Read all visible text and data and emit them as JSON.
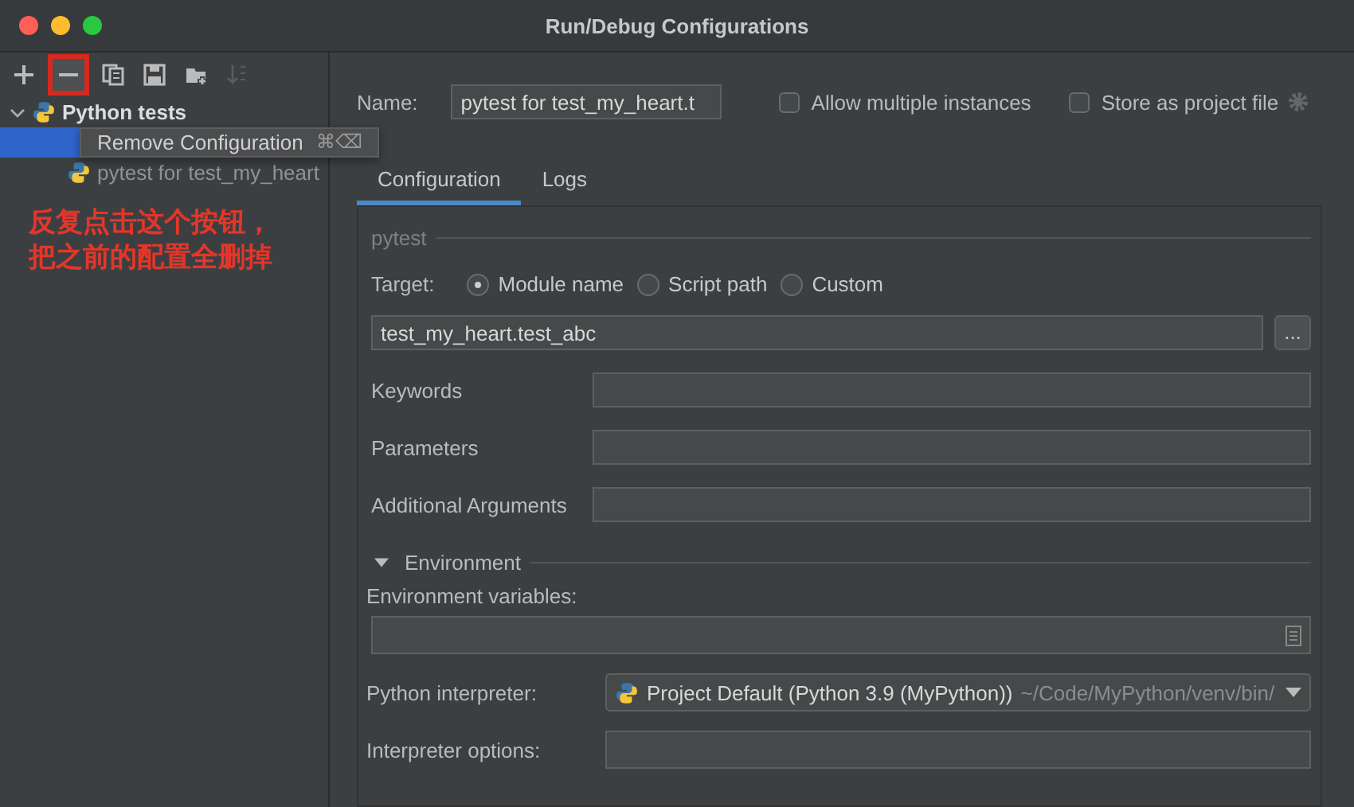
{
  "window": {
    "title": "Run/Debug Configurations"
  },
  "toolbar": [
    {
      "kind": "add",
      "disabled": false,
      "highlighted": false
    },
    {
      "kind": "remove",
      "disabled": false,
      "highlighted": true
    },
    {
      "kind": "copy",
      "disabled": false,
      "highlighted": false
    },
    {
      "kind": "save",
      "disabled": false,
      "highlighted": false
    },
    {
      "kind": "folder",
      "disabled": false,
      "highlighted": false
    },
    {
      "kind": "sort",
      "disabled": true,
      "highlighted": false
    }
  ],
  "tree": [
    {
      "label": "Python tests",
      "expanded": true,
      "children": [
        {
          "selected": true
        },
        {
          "label": "pytest for test_my_heart",
          "selected": false,
          "temporary": true
        }
      ]
    }
  ],
  "tooltip": {
    "text": "Remove Configuration",
    "shortcut": "⌘⌫"
  },
  "annotation": {
    "lines": [
      "反复点击这个按钮，",
      "把之前的配置全删掉"
    ]
  },
  "name_field": {
    "label": "Name:",
    "value": "pytest for test_my_heart.t"
  },
  "options": [
    {
      "label": "Allow multiple instances",
      "checked": false
    },
    {
      "label": "Store as project file",
      "checked": false
    }
  ],
  "tabs": [
    {
      "label": "Configuration",
      "selected": true
    },
    {
      "label": "Logs",
      "selected": false
    }
  ],
  "group": "pytest",
  "target": {
    "label": "Target:",
    "choices": [
      {
        "label": "Module name",
        "selected": true
      },
      {
        "label": "Script path",
        "selected": false
      },
      {
        "label": "Custom",
        "selected": false
      }
    ],
    "value": "test_my_heart.test_abc",
    "browse": "..."
  },
  "fields": [
    {
      "label": "Keywords"
    },
    {
      "label": "Parameters"
    },
    {
      "label": "Additional Arguments"
    }
  ],
  "environment": {
    "label": "Environment",
    "expanded": true,
    "variables_label": "Environment variables:",
    "interpreter_label": "Python interpreter:",
    "interpreter": "Project Default (Python 3.9 (MyPython))",
    "interpreter_path": "~/Code/MyPython/venv/bin/",
    "options_label": "Interpreter options:"
  }
}
